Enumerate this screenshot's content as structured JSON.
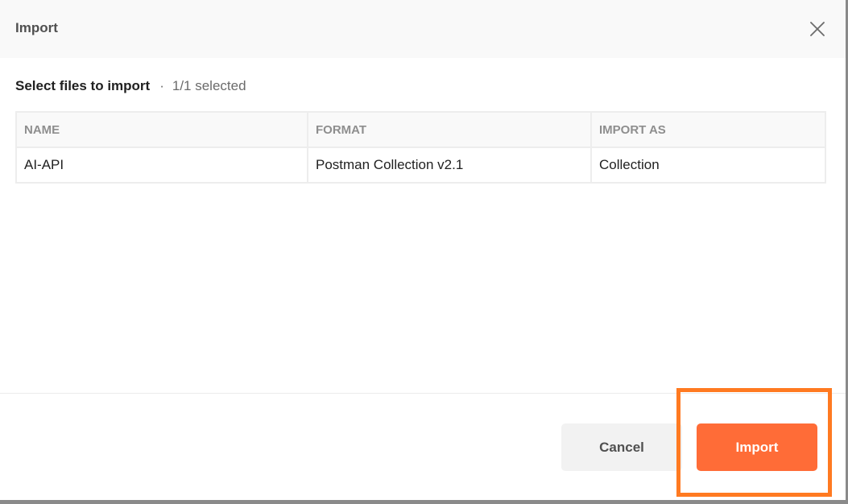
{
  "dialog": {
    "title": "Import",
    "close_icon": "close-icon"
  },
  "subheader": {
    "label": "Select files to import",
    "separator": "·",
    "selected_count": "1/1 selected"
  },
  "table": {
    "headers": [
      "NAME",
      "FORMAT",
      "IMPORT AS"
    ],
    "rows": [
      [
        "AI-API",
        "Postman Collection v2.1",
        "Collection"
      ]
    ]
  },
  "footer": {
    "cancel_label": "Cancel",
    "import_label": "Import"
  },
  "colors": {
    "accent": "#ff6c37",
    "highlight": "#ff7a21",
    "header_bg": "#f9f9f9"
  }
}
